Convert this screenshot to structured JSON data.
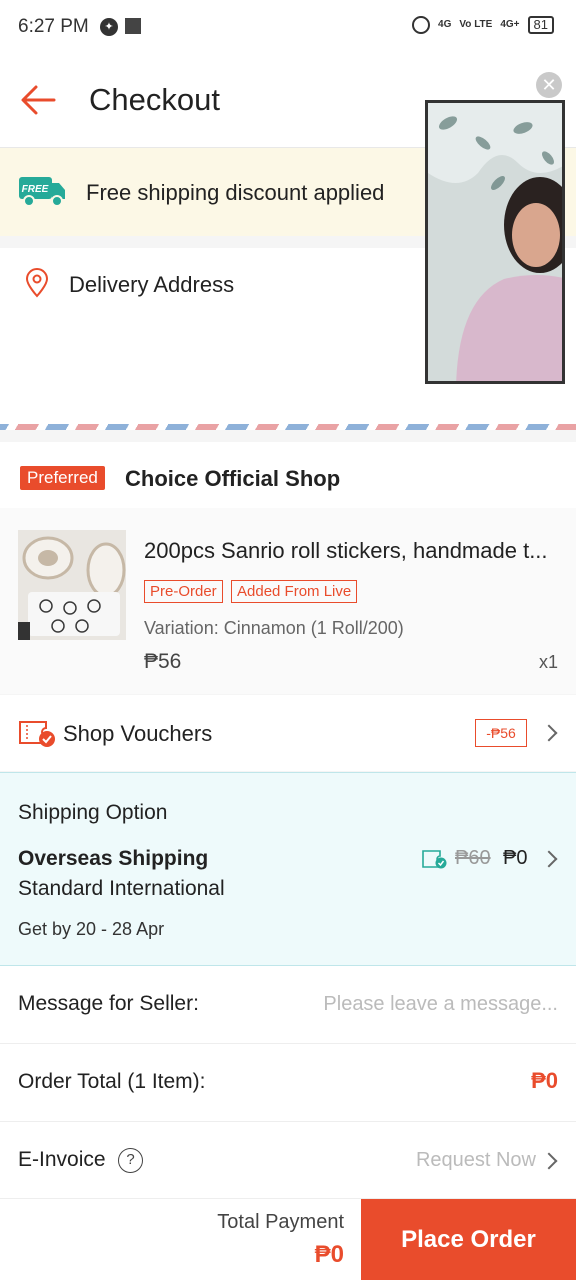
{
  "status_bar": {
    "time": "6:27 PM",
    "network_1": "4G",
    "network_2": "Vo LTE",
    "network_3": "4G+",
    "battery": "81"
  },
  "header": {
    "title": "Checkout"
  },
  "shipping_banner": {
    "badge": "FREE",
    "text": "Free shipping discount applied"
  },
  "address": {
    "label": "Delivery Address"
  },
  "shop": {
    "preferred_badge": "Preferred",
    "name": "Choice Official Shop",
    "product": {
      "name": "200pcs Sanrio roll stickers, handmade t...",
      "tags": [
        "Pre-Order",
        "Added From Live"
      ],
      "variation": "Variation: Cinnamon (1 Roll/200)",
      "price": "₱56",
      "quantity": "x1"
    }
  },
  "vouchers": {
    "label": "Shop Vouchers",
    "discount": "-₱56"
  },
  "shipping": {
    "title": "Shipping Option",
    "method": "Overseas Shipping",
    "type": "Standard International",
    "eta": "Get by 20 - 28 Apr",
    "old_price": "₱60",
    "new_price": "₱0"
  },
  "message": {
    "label": "Message for Seller:",
    "placeholder": "Please leave a message...",
    "value": ""
  },
  "order_total": {
    "label": "Order Total (1 Item):",
    "value": "₱0"
  },
  "invoice": {
    "label": "E-Invoice",
    "help": "?",
    "link": "Request Now"
  },
  "footer": {
    "total_label": "Total Payment",
    "total_value": "₱0",
    "button": "Place Order"
  },
  "colors": {
    "accent": "#e94c2c",
    "teal": "#26aa99",
    "banner_bg": "#fcf8e6",
    "shipping_bg": "#eefafb"
  },
  "icons": [
    "back-arrow-icon",
    "free-shipping-truck-icon",
    "location-pin-icon",
    "voucher-icon",
    "shipping-voucher-icon",
    "chevron-right-icon",
    "help-icon",
    "close-icon"
  ]
}
